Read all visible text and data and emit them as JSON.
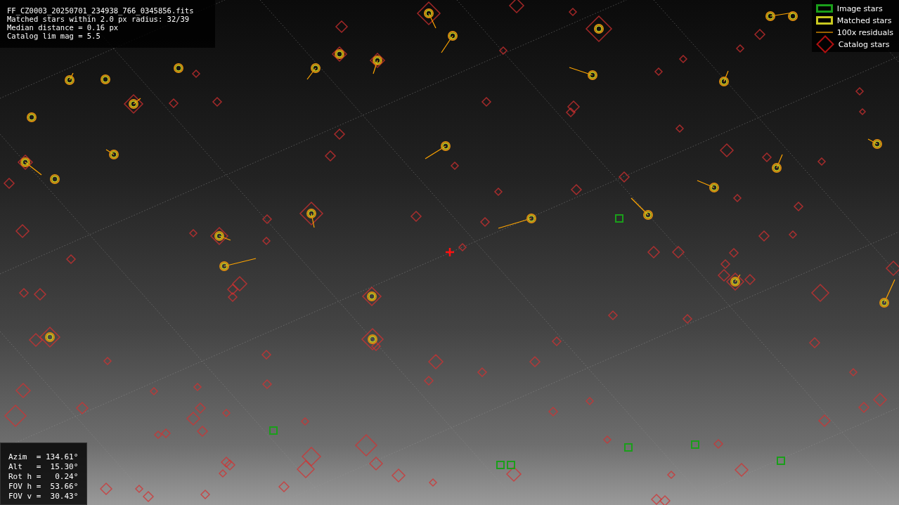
{
  "info_panel": {
    "lines": [
      "FF_CZ0003_20250701_234938_766_0345856.fits",
      "Matched stars within 2.0 px radius: 32/39",
      "Median distance = 0.16 px",
      "Catalog lim mag = 5.5"
    ]
  },
  "legend": [
    {
      "kind": "image",
      "label": "Image stars"
    },
    {
      "kind": "matched",
      "label": "Matched stars"
    },
    {
      "kind": "residual",
      "label": "100x residuals"
    },
    {
      "kind": "catalog",
      "label": "Catalog stars"
    }
  ],
  "pointing_panel": {
    "lines": [
      "Azim  = 134.61°",
      "Alt   =  15.30°",
      "Rot h =   0.24°",
      "FOV h =  53.66°",
      "FOV v =  30.43°"
    ]
  }
}
